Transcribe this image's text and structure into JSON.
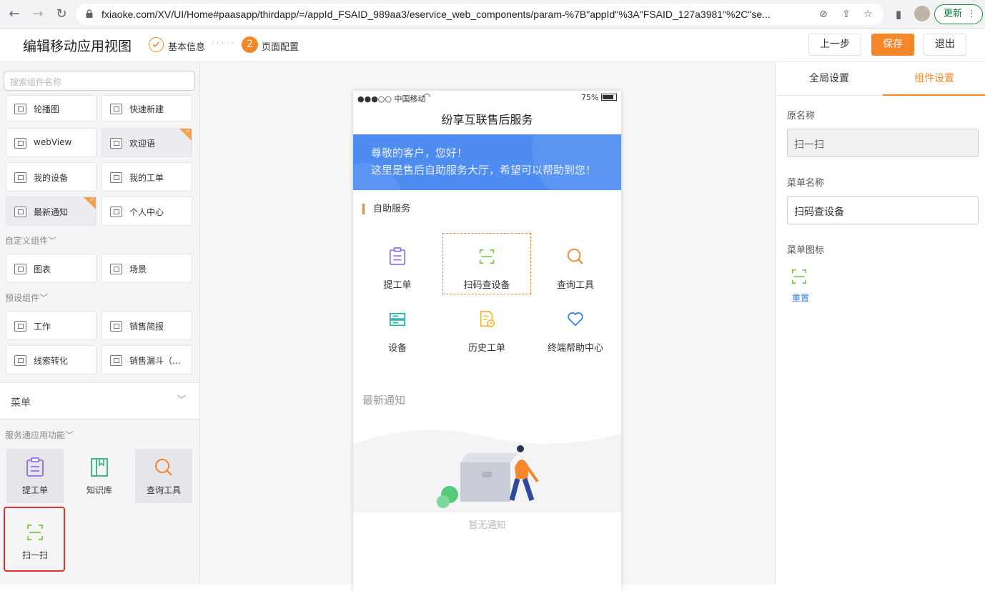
{
  "browser": {
    "url": "fxiaoke.com/XV/UI/Home#paasapp/thirdapp/=/appId_FSAID_989aa3/eservice_web_components/param-%7B\"appId\"%3A\"FSAID_127a3981\"%2C\"se...",
    "update_label": "更新"
  },
  "header": {
    "title": "编辑移动应用视图",
    "step1_label": "基本信息",
    "step2_number": "2",
    "step2_label": "页面配置",
    "prev_label": "上一步",
    "save_label": "保存",
    "exit_label": "退出"
  },
  "left": {
    "search_placeholder": "搜索组件名称",
    "components": [
      {
        "label": "轮播图"
      },
      {
        "label": "快速新建"
      },
      {
        "label": "webView"
      },
      {
        "label": "欢迎语"
      },
      {
        "label": "我的设备"
      },
      {
        "label": "我的工单"
      },
      {
        "label": "最新通知"
      },
      {
        "label": "个人中心"
      }
    ],
    "custom_section": "自定义组件",
    "custom_components": [
      {
        "label": "图表"
      },
      {
        "label": "场景"
      }
    ],
    "preset_section": "预设组件",
    "preset_components": [
      {
        "label": "工作"
      },
      {
        "label": "销售简报"
      },
      {
        "label": "线索转化"
      },
      {
        "label": "销售漏斗（..."
      }
    ],
    "menu_label": "菜单",
    "service_section": "服务通应用功能",
    "functions": [
      {
        "label": "提工单",
        "icon": "clipboard-icon"
      },
      {
        "label": "知识库",
        "icon": "book-icon"
      },
      {
        "label": "查询工具",
        "icon": "search-icon"
      },
      {
        "label": "扫一扫",
        "icon": "scan-icon"
      }
    ]
  },
  "phone": {
    "carrier": "●●●○○ 中国移动",
    "battery": "75%",
    "title": "纷享互联售后服务",
    "banner_line1": "尊敬的客户，您好！",
    "banner_line2": "这里是售后自助服务大厅，希望可以帮助到您！",
    "section_title": "自助服务",
    "tiles": [
      {
        "label": "提工单"
      },
      {
        "label": "扫码查设备"
      },
      {
        "label": "查询工具"
      },
      {
        "label": "设备"
      },
      {
        "label": "历史工单"
      },
      {
        "label": "终端帮助中心"
      }
    ],
    "notice_title": "最新通知",
    "empty_text": "暂无通知"
  },
  "right": {
    "tab_global": "全局设置",
    "tab_component": "组件设置",
    "original_name_label": "原名称",
    "original_name_value": "扫一扫",
    "menu_name_label": "菜单名称",
    "menu_name_value": "扫码查设备",
    "menu_icon_label": "菜单图标",
    "reset_label": "重置"
  },
  "colors": {
    "accent": "#f5862a",
    "banner": "#4e8cf2",
    "scan_green": "#7ac943",
    "highlight_red": "#e4312c"
  }
}
